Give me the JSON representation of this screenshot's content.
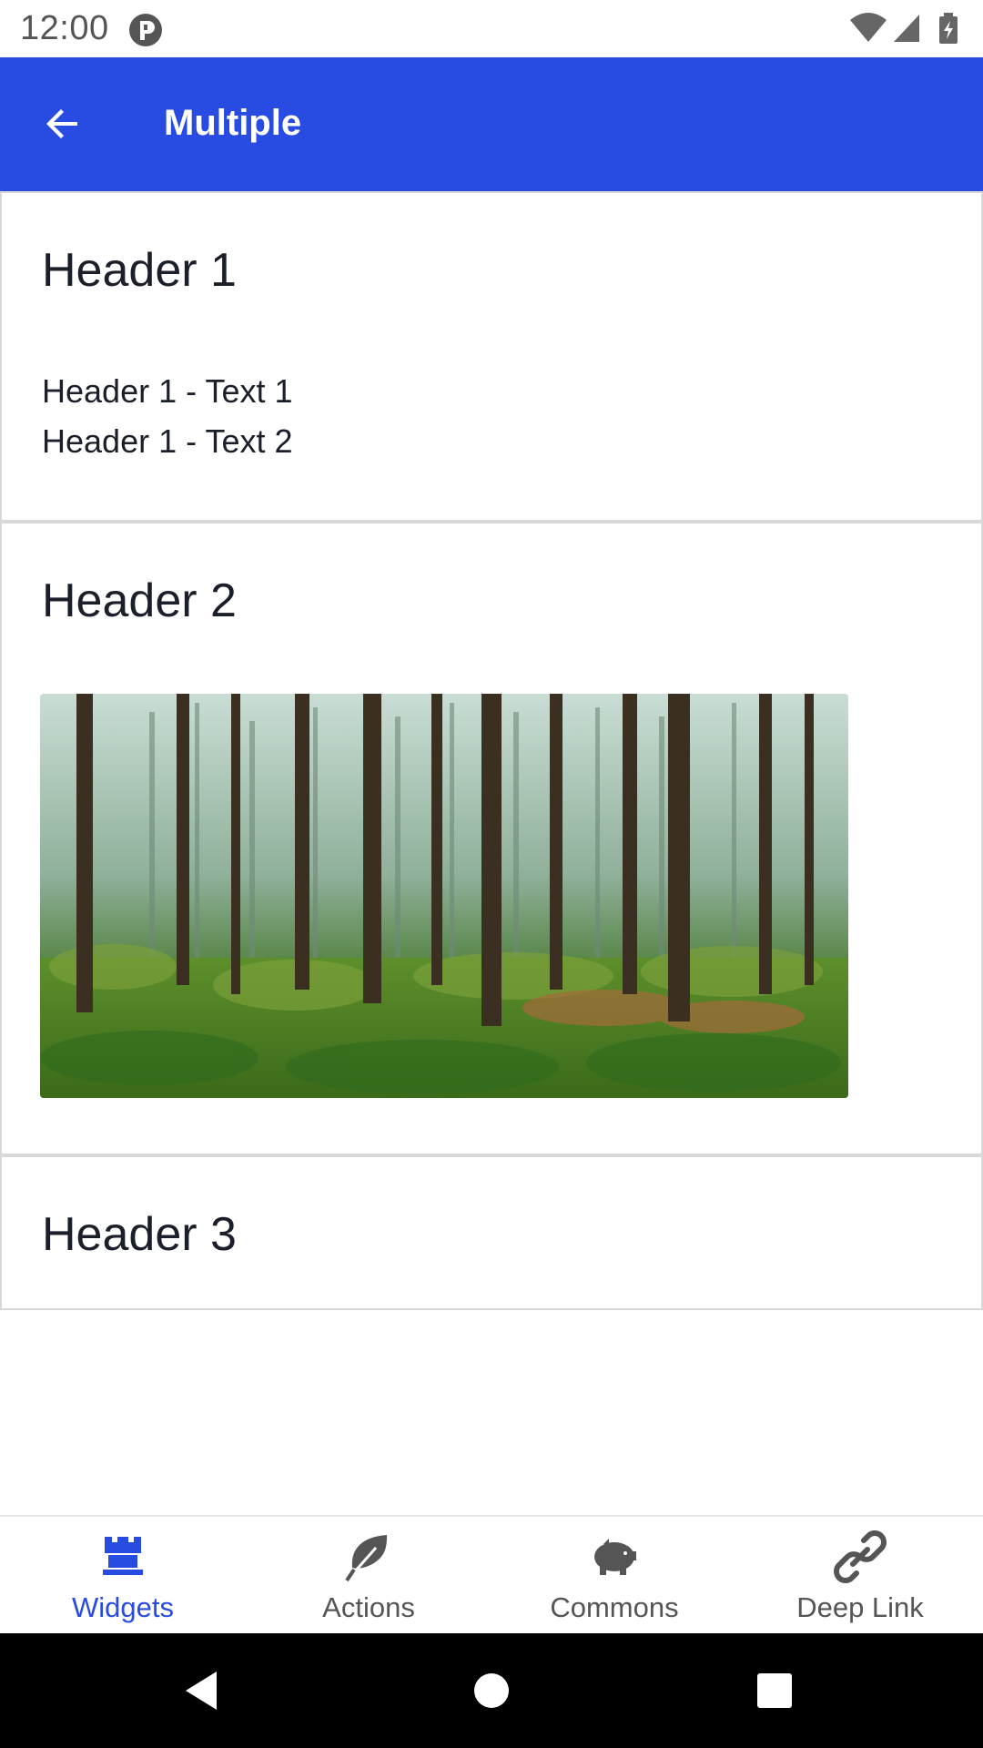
{
  "status_bar": {
    "time": "12:00"
  },
  "app_bar": {
    "title": "Multiple"
  },
  "cards": [
    {
      "header": "Header 1",
      "texts": [
        "Header 1 - Text 1",
        "Header 1 - Text 2"
      ]
    },
    {
      "header": "Header 2"
    },
    {
      "header": "Header 3"
    }
  ],
  "bottom_nav": {
    "items": [
      {
        "label": "Widgets",
        "icon": "castle-icon",
        "active": true
      },
      {
        "label": "Actions",
        "icon": "leaf-icon",
        "active": false
      },
      {
        "label": "Commons",
        "icon": "piggy-bank-icon",
        "active": false
      },
      {
        "label": "Deep Link",
        "icon": "link-icon",
        "active": false
      }
    ]
  },
  "colors": {
    "primary": "#284be2",
    "inactive": "#555555",
    "text": "#1b1f2a"
  }
}
